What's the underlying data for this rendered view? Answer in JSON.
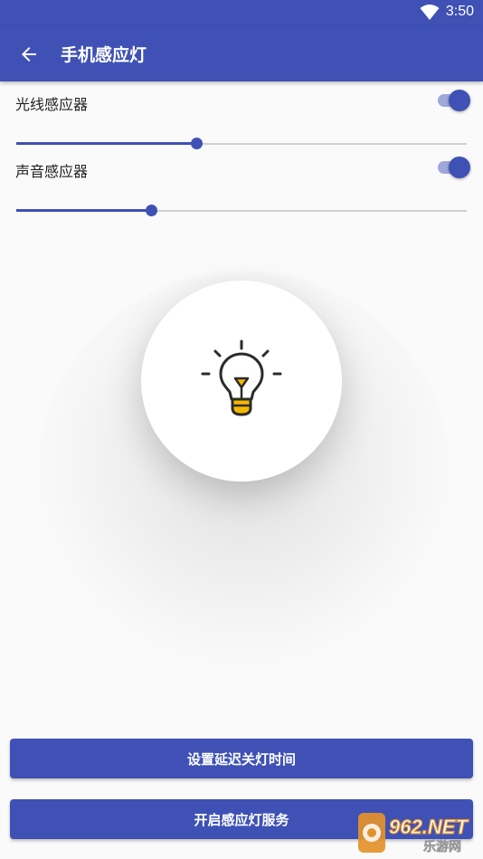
{
  "status_bar": {
    "time": "3:50",
    "wifi_icon": "wifi-icon"
  },
  "app_bar": {
    "title": "手机感应灯",
    "back_icon": "arrow-left-icon"
  },
  "light_sensor": {
    "label": "光线感应器",
    "enabled": true,
    "level": 0.4
  },
  "sound_sensor": {
    "label": "声音感应器",
    "enabled": true,
    "level": 0.3
  },
  "bulb": {
    "icon": "lightbulb-icon"
  },
  "buttons": {
    "set_delay": "设置延迟关灯时间",
    "start_service": "开启感应灯服务"
  },
  "watermark": {
    "brand": "962.NET",
    "sub": "乐游网"
  },
  "colors": {
    "primary": "#3f51b5",
    "primary_light": "#9fa8da",
    "bulb_base": "#f5b800"
  }
}
